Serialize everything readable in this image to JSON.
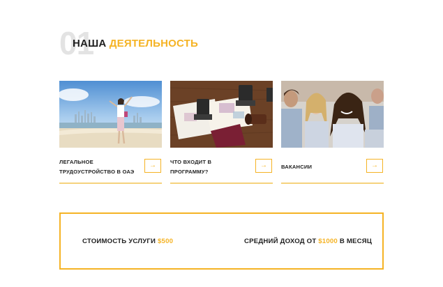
{
  "section": {
    "number": "01",
    "title_part1": "НАША",
    "title_part2": "ДЕЯТЕЛЬНОСТЬ"
  },
  "cards": [
    {
      "label": "ЛЕГАЛЬНОЕ ТРУДОУСТРОЙСТВО В ОАЭ",
      "image": "beach-city-skyline-woman",
      "arrow": "→"
    },
    {
      "label": "ЧТО ВХОДИТ В ПРОГРАММУ?",
      "image": "passport-visa-stamps",
      "arrow": "→"
    },
    {
      "label": "ВАКАНСИИ",
      "image": "smiling-students-group",
      "arrow": "→"
    }
  ],
  "pricing": {
    "cost_label": "СТОИМОСТЬ УСЛУГИ",
    "cost_value": "$500",
    "income_label": "СРЕДНИЙ ДОХОД ОТ",
    "income_value": "$1000",
    "income_suffix": "В МЕСЯЦ"
  },
  "colors": {
    "accent": "#f5b324",
    "text": "#1f1f1f",
    "number_ghost": "#e3e3e3"
  }
}
